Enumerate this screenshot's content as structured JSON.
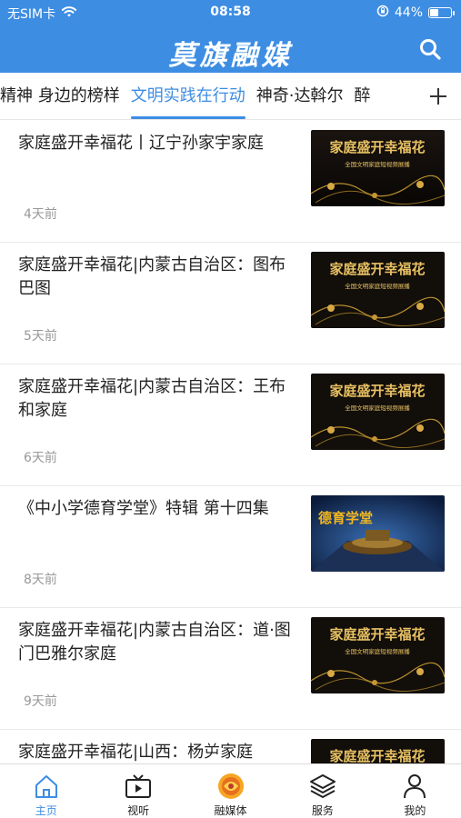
{
  "status": {
    "carrier": "无SIM卡",
    "time": "08:58",
    "battery": "44%",
    "battery_level": 0.44
  },
  "header": {
    "title": "莫旗融媒",
    "search_icon": "search-icon"
  },
  "tabs": [
    {
      "label": "精神 身边的榜样",
      "active": false
    },
    {
      "label": "文明实践在行动",
      "active": true
    },
    {
      "label": "神奇·达斡尔",
      "active": false
    },
    {
      "label": "醉",
      "active": false
    }
  ],
  "tab_add_icon": "plus-icon",
  "list": [
    {
      "title": "家庭盛开幸福花丨辽宁孙家宇家庭",
      "time": "4天前",
      "thumb": "family-banner"
    },
    {
      "title": "家庭盛开幸福花|内蒙古自治区：图布巴图",
      "time": "5天前",
      "thumb": "family-banner"
    },
    {
      "title": "家庭盛开幸福花|内蒙古自治区：王布和家庭",
      "time": "6天前",
      "thumb": "family-banner"
    },
    {
      "title": "《中小学德育学堂》特辑 第十四集",
      "time": "8天前",
      "thumb": "moral-classroom"
    },
    {
      "title": "家庭盛开幸福花|内蒙古自治区：道·图门巴雅尔家庭",
      "time": "9天前",
      "thumb": "family-banner"
    },
    {
      "title": "家庭盛开幸福花|山西：杨屰家庭",
      "time": "",
      "thumb": "family-banner"
    }
  ],
  "thumb_text": {
    "family_title": "家庭盛开幸福花",
    "family_sub": "全国文明家庭短视频展播",
    "classroom_title": "德育学堂"
  },
  "bottomnav": [
    {
      "label": "主页",
      "icon": "home-icon",
      "active": true
    },
    {
      "label": "视听",
      "icon": "video-icon",
      "active": false
    },
    {
      "label": "融媒体",
      "icon": "media-logo-icon",
      "active": false
    },
    {
      "label": "服务",
      "icon": "layers-icon",
      "active": false
    },
    {
      "label": "我的",
      "icon": "person-icon",
      "active": false
    }
  ],
  "colors": {
    "brand": "#3d8de3",
    "text": "#222222",
    "muted": "#999999"
  }
}
